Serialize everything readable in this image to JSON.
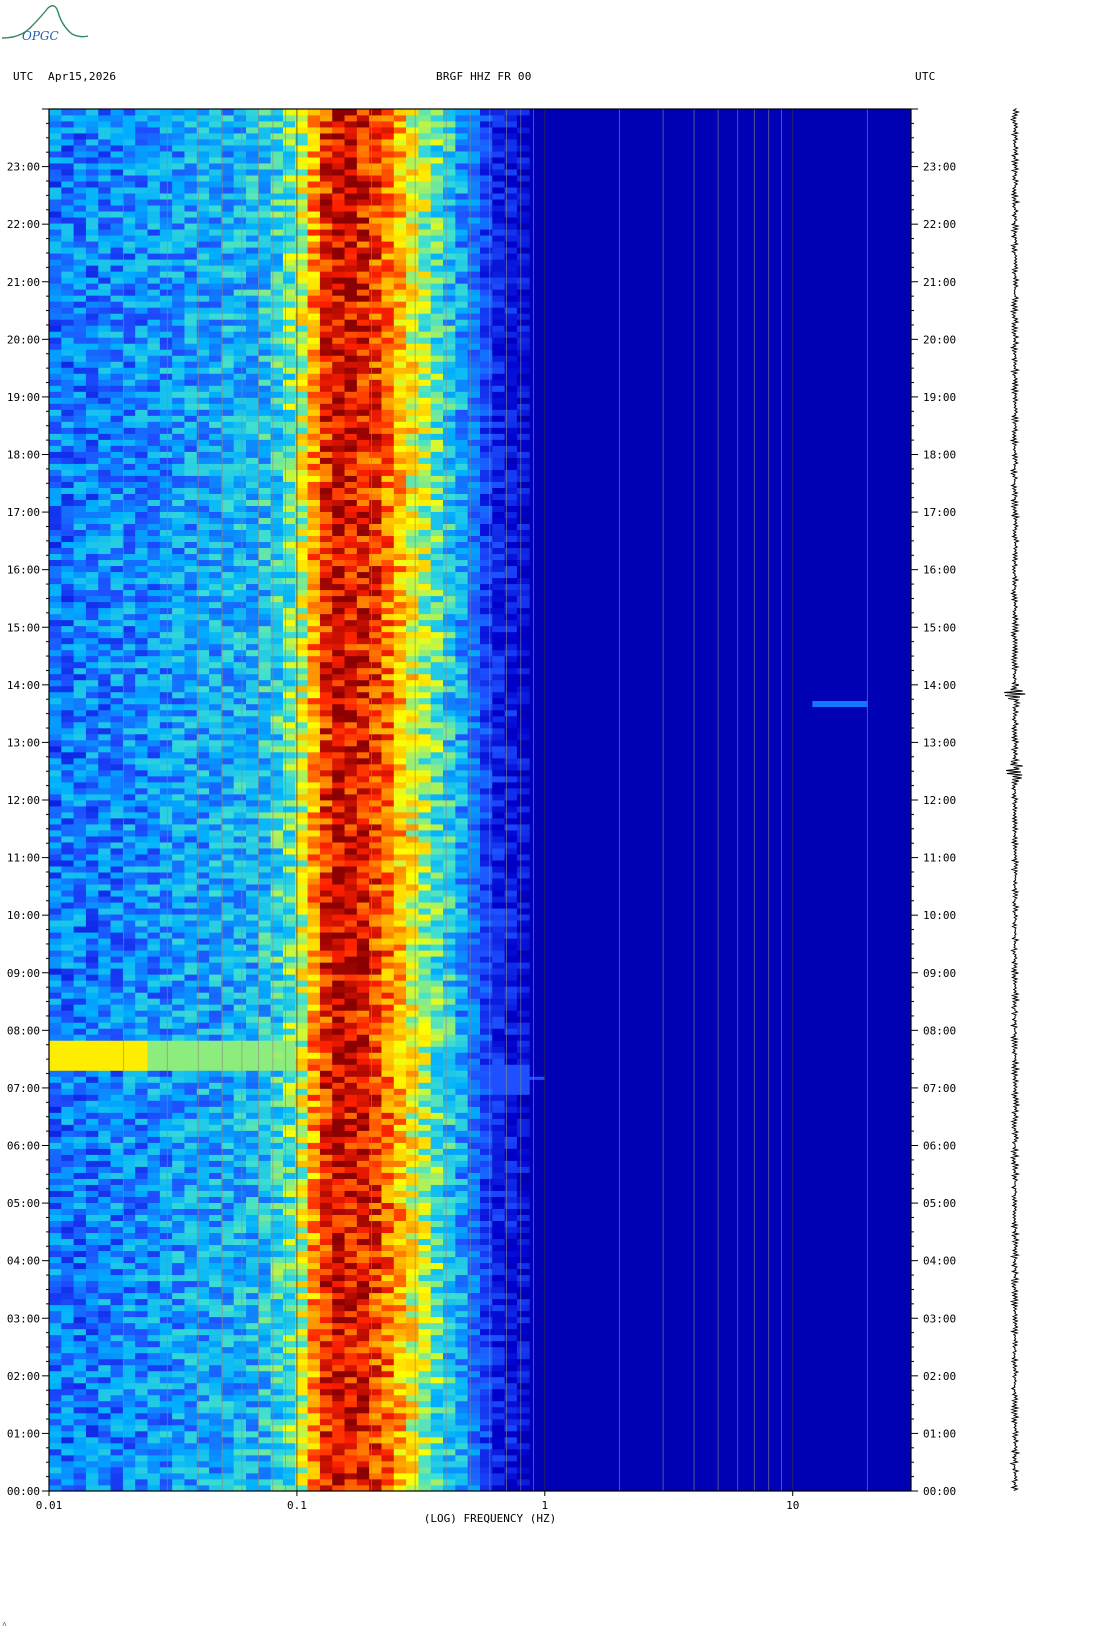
{
  "logo": {
    "text": "OPGC",
    "color": "#2e8b57"
  },
  "header": {
    "left_tz": "UTC",
    "date": "Apr15,2026",
    "station": "BRGF HHZ FR 00",
    "right_tz": "UTC"
  },
  "chart_data": {
    "type": "heatmap",
    "title": "BRGF HHZ FR 00",
    "xlabel": "(LOG) FREQUENCY (HZ)",
    "ylabel": "",
    "x_scale": "log",
    "xlim": [
      0.01,
      30
    ],
    "x_ticks": [
      0.01,
      0.1,
      1,
      10
    ],
    "x_tick_labels": [
      "0.01",
      "0.1",
      "1",
      "10"
    ],
    "y_ticks": [
      "00:00",
      "01:00",
      "02:00",
      "03:00",
      "04:00",
      "05:00",
      "06:00",
      "07:00",
      "08:00",
      "09:00",
      "10:00",
      "11:00",
      "12:00",
      "13:00",
      "14:00",
      "15:00",
      "16:00",
      "17:00",
      "18:00",
      "19:00",
      "20:00",
      "21:00",
      "22:00",
      "23:00"
    ],
    "ylim_hours": [
      0,
      24
    ],
    "colormap": [
      "#00008b",
      "#0000cd",
      "#1e50ff",
      "#00b0ff",
      "#40e0d0",
      "#ffff00",
      "#ffa500",
      "#ff2000",
      "#8b0000"
    ],
    "spectral_profile": [
      {
        "f": 0.01,
        "level": 0.3
      },
      {
        "f": 0.025,
        "level": 0.34
      },
      {
        "f": 0.07,
        "level": 0.4
      },
      {
        "f": 0.09,
        "level": 0.48
      },
      {
        "f": 0.1,
        "level": 0.55
      },
      {
        "f": 0.12,
        "level": 0.78
      },
      {
        "f": 0.14,
        "level": 0.95
      },
      {
        "f": 0.2,
        "level": 0.88
      },
      {
        "f": 0.27,
        "level": 0.7
      },
      {
        "f": 0.35,
        "level": 0.52
      },
      {
        "f": 0.5,
        "level": 0.32
      },
      {
        "f": 0.6,
        "level": 0.2
      },
      {
        "f": 1.0,
        "level": 0.1
      },
      {
        "f": 30,
        "level": 0.06
      }
    ],
    "events": [
      {
        "time": "07:35",
        "f_min": 0.01,
        "f_max": 0.1,
        "level": 0.55
      },
      {
        "time": "13:40",
        "f_min": 12,
        "f_max": 20,
        "level": 0.3
      },
      {
        "time": "07:10",
        "f_min": 0.5,
        "f_max": 1.0,
        "level": 0.25
      }
    ],
    "seismogram_events": [
      "13:50",
      "12:30"
    ]
  }
}
